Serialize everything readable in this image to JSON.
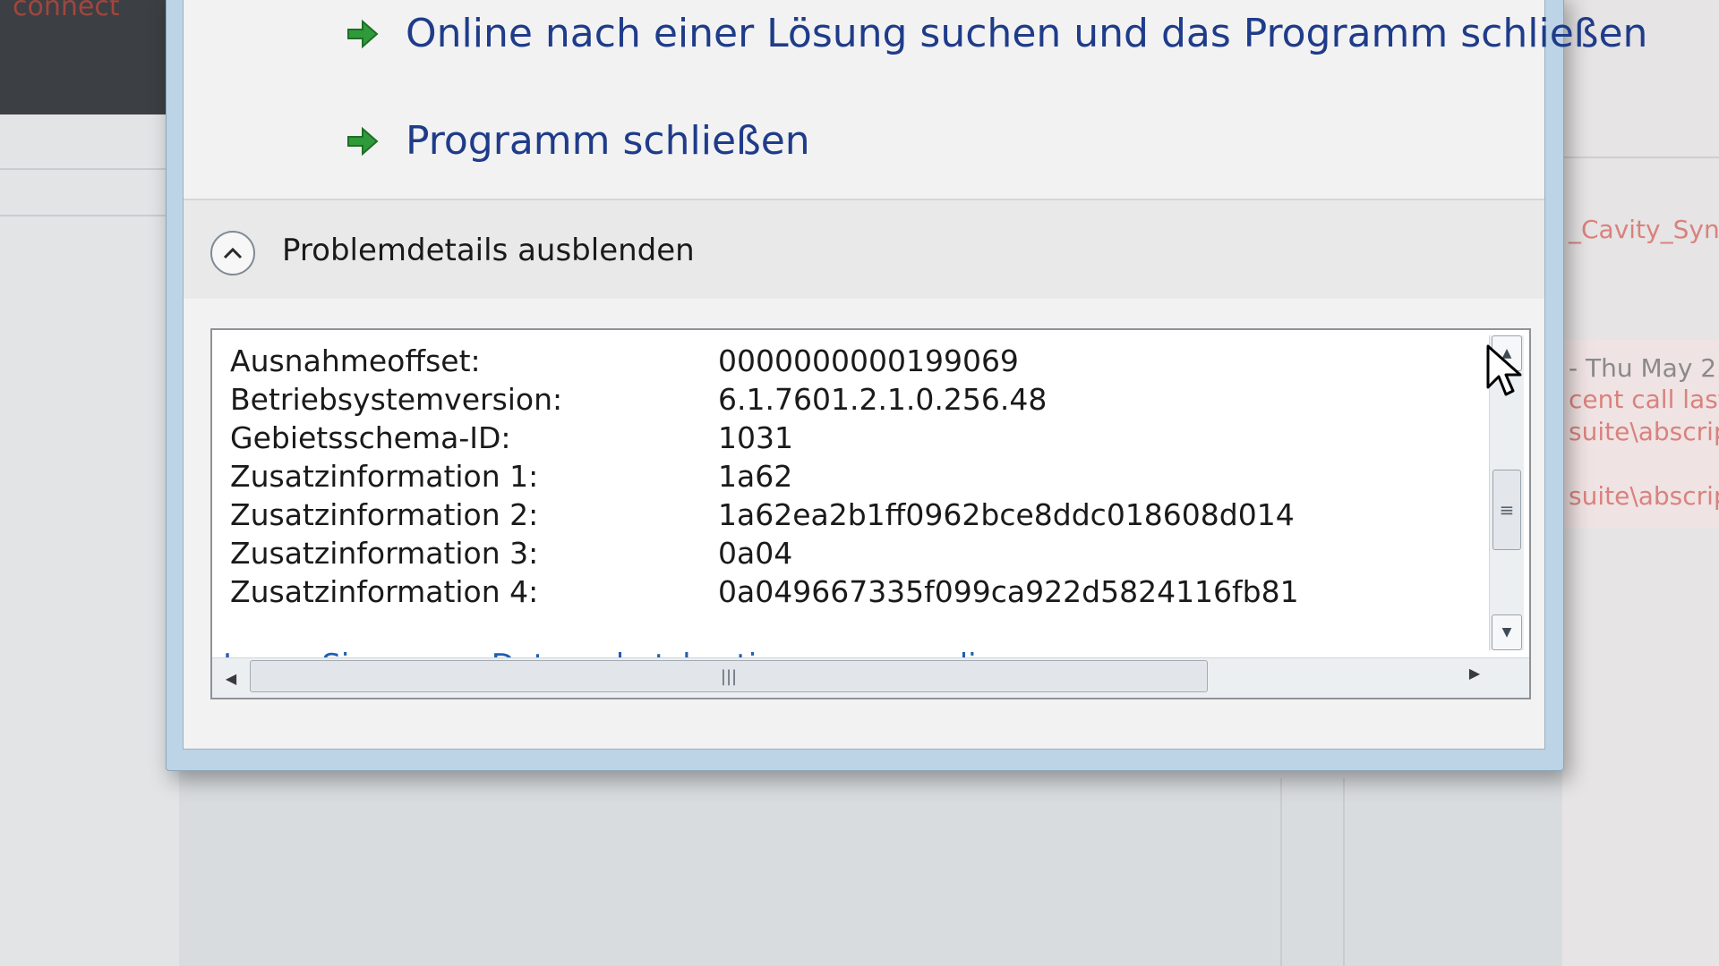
{
  "background": {
    "top_left_text": "connect",
    "right_texts": [
      {
        "text": "_Cavity_Synth",
        "color": "red"
      },
      {
        "text": "- Thu May 2",
        "color": "gray"
      },
      {
        "text": "cent call last)",
        "color": "red"
      },
      {
        "text": "suite\\abscript",
        "color": "red"
      },
      {
        "text": "suite\\abscript",
        "color": "red"
      }
    ]
  },
  "dialog": {
    "actions": [
      {
        "label": "Online nach einer Lösung suchen und das Programm schließen",
        "icon": "green-arrow-icon"
      },
      {
        "label": "Programm schließen",
        "icon": "green-arrow-icon"
      }
    ],
    "details_toggle": {
      "label": "Problemdetails ausblenden",
      "icon": "chevron-up-icon"
    },
    "details": [
      {
        "key": "Ausnahmeoffset:",
        "value": "0000000000199069"
      },
      {
        "key": "Betriebsystemversion:",
        "value": "6.1.7601.2.1.0.256.48"
      },
      {
        "key": "Gebietsschema-ID:",
        "value": "1031"
      },
      {
        "key": "Zusatzinformation 1:",
        "value": "1a62"
      },
      {
        "key": "Zusatzinformation 2:",
        "value": "1a62ea2b1ff0962bce8ddc018608d014"
      },
      {
        "key": "Zusatzinformation 3:",
        "value": "0a04"
      },
      {
        "key": "Zusatzinformation 4:",
        "value": "0a049667335f099ca922d5824116fb81"
      }
    ],
    "privacy_link": "Lesen Sie unsere Datenschutzbestimmungen online:"
  },
  "colors": {
    "link": "#1f5fb0",
    "action_text": "#1f3c8a",
    "arrow": "#2f9a3a"
  }
}
